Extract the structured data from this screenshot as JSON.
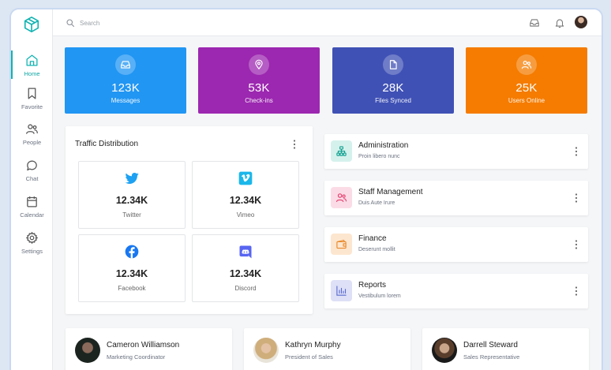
{
  "sidebar": {
    "items": [
      {
        "label": "Home",
        "icon": "home-icon",
        "active": true
      },
      {
        "label": "Favorite",
        "icon": "bookmark-icon"
      },
      {
        "label": "People",
        "icon": "people-icon"
      },
      {
        "label": "Chat",
        "icon": "chat-icon"
      },
      {
        "label": "Calendar",
        "icon": "calendar-icon"
      },
      {
        "label": "Settings",
        "icon": "gear-icon"
      }
    ],
    "accent": "#10b3b1"
  },
  "search": {
    "placeholder": "Search"
  },
  "stats": [
    {
      "value": "123K",
      "label": "Messages",
      "color": "#2196f3",
      "icon": "inbox-icon"
    },
    {
      "value": "53K",
      "label": "Check-ins",
      "color": "#9c27b0",
      "icon": "location-pin-icon"
    },
    {
      "value": "28K",
      "label": "Files Synced",
      "color": "#3f51b5",
      "icon": "file-icon"
    },
    {
      "value": "25K",
      "label": "Users Online",
      "color": "#f57c00",
      "icon": "users-icon"
    }
  ],
  "traffic": {
    "title": "Traffic Distribution",
    "sources": [
      {
        "value": "12.34K",
        "label": "Twitter",
        "icon": "twitter-icon",
        "color": "#1da1f2"
      },
      {
        "value": "12.34K",
        "label": "Vimeo",
        "icon": "vimeo-icon",
        "color": "#1ab7ea"
      },
      {
        "value": "12.34K",
        "label": "Facebook",
        "icon": "facebook-icon",
        "color": "#1877f2"
      },
      {
        "value": "12.34K",
        "label": "Discord",
        "icon": "discord-icon",
        "color": "#5865f2"
      }
    ]
  },
  "departments": [
    {
      "title": "Administration",
      "subtitle": "Proin libero nunc",
      "icon": "org-chart-icon",
      "color": "#0e9f8f",
      "bg": "#d5f1ec"
    },
    {
      "title": "Staff Management",
      "subtitle": "Duis Aute Irure",
      "icon": "users-icon",
      "color": "#e53e6f",
      "bg": "#fbdce6"
    },
    {
      "title": "Finance",
      "subtitle": "Deserunt mollit",
      "icon": "wallet-icon",
      "color": "#e8892a",
      "bg": "#fde6cf"
    },
    {
      "title": "Reports",
      "subtitle": "Vestibulum lorem",
      "icon": "bar-chart-icon",
      "color": "#5a6acf",
      "bg": "#dde0f6"
    }
  ],
  "people": [
    {
      "name": "Cameron Williamson",
      "role": "Marketing Coordinator"
    },
    {
      "name": "Kathryn Murphy",
      "role": "President of Sales"
    },
    {
      "name": "Darrell Steward",
      "role": "Sales Representative"
    }
  ]
}
